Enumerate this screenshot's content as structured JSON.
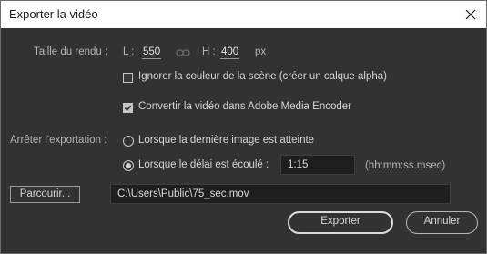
{
  "window": {
    "title": "Exporter la vidéo"
  },
  "size": {
    "label": "Taille du rendu :",
    "width_label": "L :",
    "width_value": "550",
    "height_label": "H :",
    "height_value": "400",
    "unit": "px"
  },
  "options": {
    "ignore_color": {
      "label": "Ignorer la couleur de la scène (créer un calque alpha)",
      "checked": false
    },
    "convert": {
      "label": "Convertir la vidéo dans Adobe Media Encoder",
      "checked": true
    }
  },
  "stop": {
    "label": "Arrêter l'exportation :",
    "last_frame": {
      "label": "Lorsque la dernière image est atteinte",
      "selected": false
    },
    "delay": {
      "label": "Lorsque le délai est écoulé :",
      "selected": true,
      "value": "1:15",
      "format": "(hh:mm:ss.msec)"
    }
  },
  "browse": {
    "button": "Parcourir...",
    "path": "C:\\Users\\Public\\75_sec.mov"
  },
  "buttons": {
    "export": "Exporter",
    "cancel": "Annuler"
  }
}
